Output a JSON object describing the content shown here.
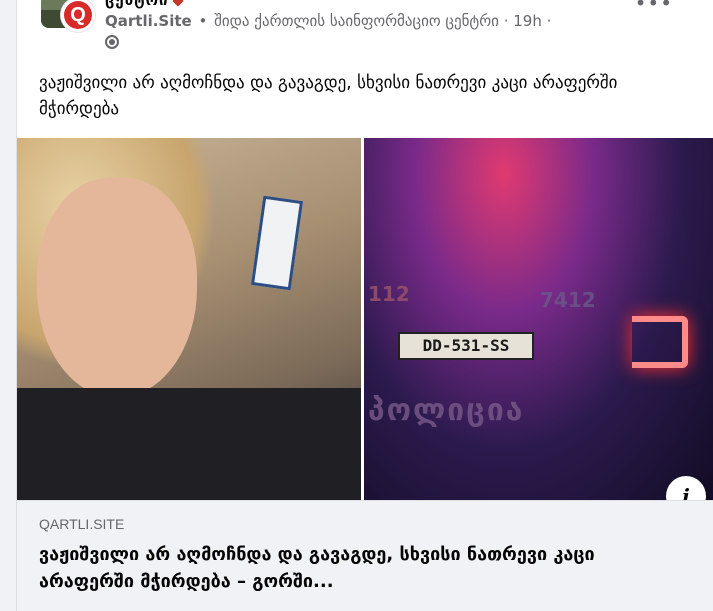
{
  "post": {
    "name_clipped": "ცენტრი",
    "page_name": "Qartli.Site",
    "separator": " • ",
    "group_name": "შიდა ქართლის საინფორმაციო ცენტრი",
    "time": "19h",
    "audience_icon": "globe-icon",
    "more_icon": "more-horizontal-icon",
    "more_label": "•••",
    "caption": "ვაჟიშვილი არ აღმოჩნდა და გავაგდე, სხვისი ნათრევი კაცი არაფერში მჭირდება",
    "logo_letter": "Q"
  },
  "media": {
    "plate": "DD-531-SS",
    "car_number_right": "7412",
    "car_number_left": "112",
    "car_text": "პოლიცია",
    "info_label": "i"
  },
  "link_preview": {
    "domain": "QARTLI.SITE",
    "title": "ვაჟიშვილი არ აღმოჩნდა და გავაგდე, სხვისი ნათრევი კაცი არაფერში მჭირდება – გორში..."
  },
  "colors": {
    "brand_red": "#d92a2a",
    "secondary_text": "#65676b",
    "background": "#f0f2f5"
  }
}
